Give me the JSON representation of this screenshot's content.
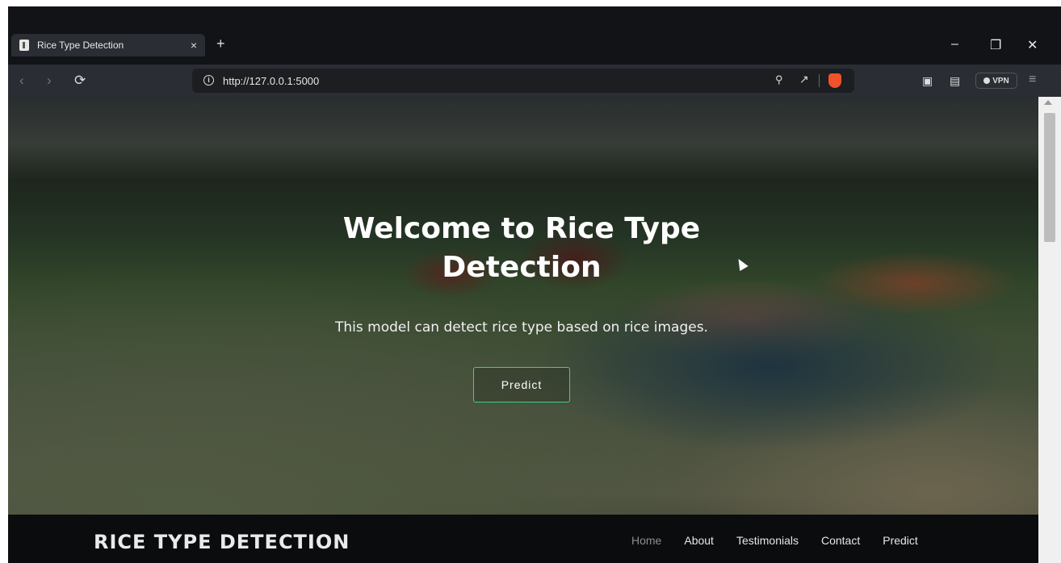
{
  "browser": {
    "tab_title": "Rice Type Detection",
    "tab_close": "×",
    "new_tab": "+",
    "window": {
      "minimize": "–",
      "restore": "❐",
      "close": "✕"
    },
    "nav": {
      "back": "‹",
      "forward": "›",
      "reload": "⟳"
    },
    "url": "http://127.0.0.1:5000",
    "vpn_label": "VPN",
    "menu": "≡"
  },
  "hero": {
    "title": "Welcome to Rice Type Detection",
    "subtitle": "This model can detect rice type based on rice images.",
    "button": "Predict"
  },
  "navbar": {
    "brand": "RICE TYPE DETECTION",
    "links": [
      "Home",
      "About",
      "Testimonials",
      "Contact",
      "Predict"
    ],
    "active": "Home"
  },
  "colors": {
    "button_border": "#3ccf8e",
    "navbar_bg": "#0b0c0d",
    "active_link": "#8a8f94"
  }
}
